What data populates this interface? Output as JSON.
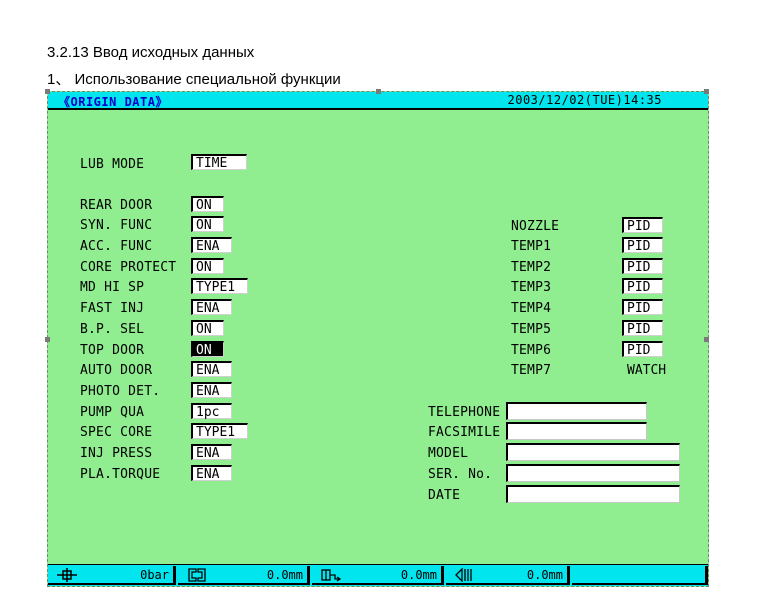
{
  "doc": {
    "heading": "3.2.13 Ввод исходных данных",
    "subheading": "1、 Использование специальной функции"
  },
  "screen": {
    "title": "《ORIGIN DATA》",
    "datetime": "2003/12/02(TUE)14:35",
    "lub_mode": {
      "label": "LUB MODE",
      "value": "TIME"
    },
    "settings": [
      {
        "label": "REAR DOOR",
        "value": "ON"
      },
      {
        "label": "SYN. FUNC",
        "value": "ON"
      },
      {
        "label": "ACC. FUNC",
        "value": "ENA"
      },
      {
        "label": "CORE PROTECT",
        "value": "ON"
      },
      {
        "label": "MD HI SP",
        "value": "TYPE1"
      },
      {
        "label": "FAST INJ",
        "value": "ENA"
      },
      {
        "label": "B.P. SEL",
        "value": "ON"
      },
      {
        "label": "TOP DOOR",
        "value": "ON"
      },
      {
        "label": "AUTO DOOR",
        "value": "ENA"
      },
      {
        "label": "PHOTO DET.",
        "value": "ENA"
      },
      {
        "label": "PUMP QUA",
        "value": "1pc"
      },
      {
        "label": "SPEC CORE",
        "value": "TYPE1"
      },
      {
        "label": "INJ PRESS",
        "value": "ENA"
      },
      {
        "label": "PLA.TORQUE",
        "value": "ENA"
      }
    ],
    "temps": [
      {
        "label": "NOZZLE",
        "value": "PID"
      },
      {
        "label": "TEMP1",
        "value": "PID"
      },
      {
        "label": "TEMP2",
        "value": "PID"
      },
      {
        "label": "TEMP3",
        "value": "PID"
      },
      {
        "label": "TEMP4",
        "value": "PID"
      },
      {
        "label": "TEMP5",
        "value": "PID"
      },
      {
        "label": "TEMP6",
        "value": "PID"
      },
      {
        "label": "TEMP7",
        "value": "WATCH"
      }
    ],
    "info": [
      {
        "label": "TELEPHONE",
        "value": ""
      },
      {
        "label": "FACSIMILE",
        "value": ""
      },
      {
        "label": "MODEL",
        "value": ""
      },
      {
        "label": "SER. No.",
        "value": ""
      },
      {
        "label": "DATE",
        "value": ""
      }
    ],
    "status": [
      {
        "icon": "pressure-icon",
        "value": "0bar"
      },
      {
        "icon": "mold-position-icon",
        "value": "0.0mm"
      },
      {
        "icon": "injection-position-icon",
        "value": "0.0mm"
      },
      {
        "icon": "ejector-position-icon",
        "value": "0.0mm"
      },
      {
        "icon": "",
        "value": ""
      }
    ]
  }
}
